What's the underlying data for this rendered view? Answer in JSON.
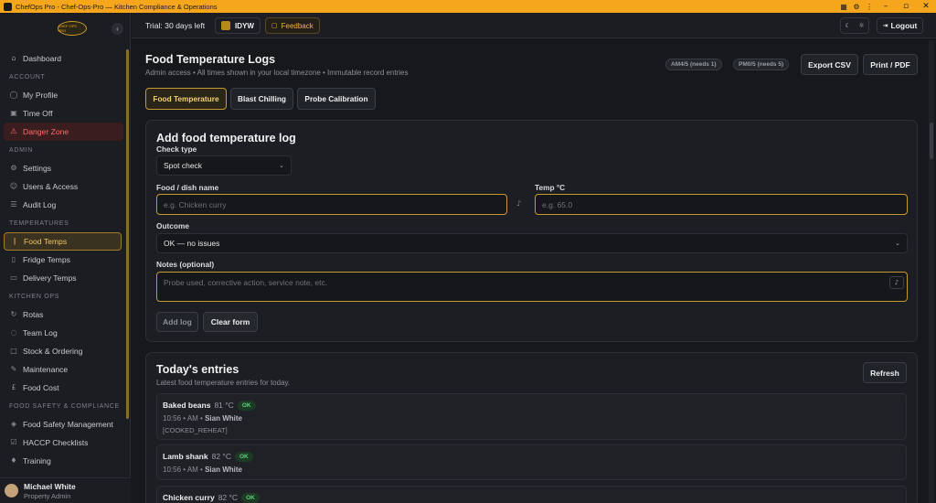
{
  "window": {
    "title": "ChefOps Pro - Chef-Ops-Pro — Kitchen Compliance & Operations"
  },
  "sidebar": {
    "logo_text": "CHEF OPS PRO",
    "items_top": [
      {
        "label": "Dashboard",
        "icon": "home-icon"
      }
    ],
    "sections": [
      {
        "title": "ACCOUNT",
        "items": [
          {
            "label": "My Profile",
            "icon": "user-icon"
          },
          {
            "label": "Time Off",
            "icon": "calendar-icon"
          },
          {
            "label": "Danger Zone",
            "icon": "warning-icon"
          }
        ]
      },
      {
        "title": "ADMIN",
        "items": [
          {
            "label": "Settings",
            "icon": "gear-icon"
          },
          {
            "label": "Users & Access",
            "icon": "users-icon"
          },
          {
            "label": "Audit Log",
            "icon": "list-icon"
          }
        ]
      },
      {
        "title": "TEMPERATURES",
        "items": [
          {
            "label": "Food Temps",
            "icon": "thermometer-icon"
          },
          {
            "label": "Fridge Temps",
            "icon": "fridge-icon"
          },
          {
            "label": "Delivery Temps",
            "icon": "truck-icon"
          }
        ]
      },
      {
        "title": "KITCHEN OPS",
        "items": [
          {
            "label": "Rotas",
            "icon": "rota-icon"
          },
          {
            "label": "Team Log",
            "icon": "chat-icon"
          },
          {
            "label": "Stock & Ordering",
            "icon": "box-icon"
          },
          {
            "label": "Maintenance",
            "icon": "wrench-icon"
          },
          {
            "label": "Food Cost",
            "icon": "pound-icon"
          }
        ]
      },
      {
        "title": "FOOD SAFETY & COMPLIANCE",
        "items": [
          {
            "label": "Food Safety Management",
            "icon": "shield-icon"
          },
          {
            "label": "HACCP Checklists",
            "icon": "checklist-icon"
          },
          {
            "label": "Training",
            "icon": "graduation-icon"
          }
        ]
      }
    ],
    "user": {
      "name": "Michael White",
      "role": "Property Admin"
    }
  },
  "topbar": {
    "trial": "Trial: 30 days left",
    "org_code": "IDYW",
    "feedback": "Feedback",
    "logout": "Logout"
  },
  "page": {
    "title": "Food Temperature Logs",
    "subtitle": "Admin access • All times shown in your local timezone • Immutable record entries",
    "am_count": "AM4/5 (needs 1)",
    "pm_count": "PM0/5 (needs 5)",
    "export_csv": "Export CSV",
    "print_pdf": "Print / PDF"
  },
  "tabs": [
    {
      "label": "Food Temperature"
    },
    {
      "label": "Blast Chilling"
    },
    {
      "label": "Probe Calibration"
    }
  ],
  "form": {
    "title": "Add food temperature log",
    "check_type_label": "Check type",
    "check_type_value": "Spot check",
    "dish_label": "Food / dish name",
    "dish_placeholder": "e.g. Chicken curry",
    "temp_label": "Temp °C",
    "temp_placeholder": "e.g. 65.0",
    "outcome_label": "Outcome",
    "outcome_value": "OK — no issues",
    "notes_label": "Notes (optional)",
    "notes_placeholder": "Probe used, corrective action, service note, etc.",
    "add_log": "Add log",
    "clear_form": "Clear form"
  },
  "entries": {
    "title": "Today's entries",
    "subtitle": "Latest food temperature entries for today.",
    "refresh": "Refresh",
    "ok_label": "OK",
    "items": [
      {
        "dish": "Baked beans",
        "temp": "81 °C",
        "time": "10:56 • AM •",
        "user": "Sian White",
        "tag": "[COOKED_REHEAT]"
      },
      {
        "dish": "Lamb shank",
        "temp": "82 °C",
        "time": "10:56 • AM •",
        "user": "Sian White",
        "tag": ""
      },
      {
        "dish": "Chicken curry",
        "temp": "82 °C",
        "time": "",
        "user": "",
        "tag": ""
      }
    ]
  },
  "colors": {
    "accent": "#f5a61c",
    "danger": "#ff6b6b",
    "ok": "#5fd07a",
    "background": "#16181c"
  }
}
